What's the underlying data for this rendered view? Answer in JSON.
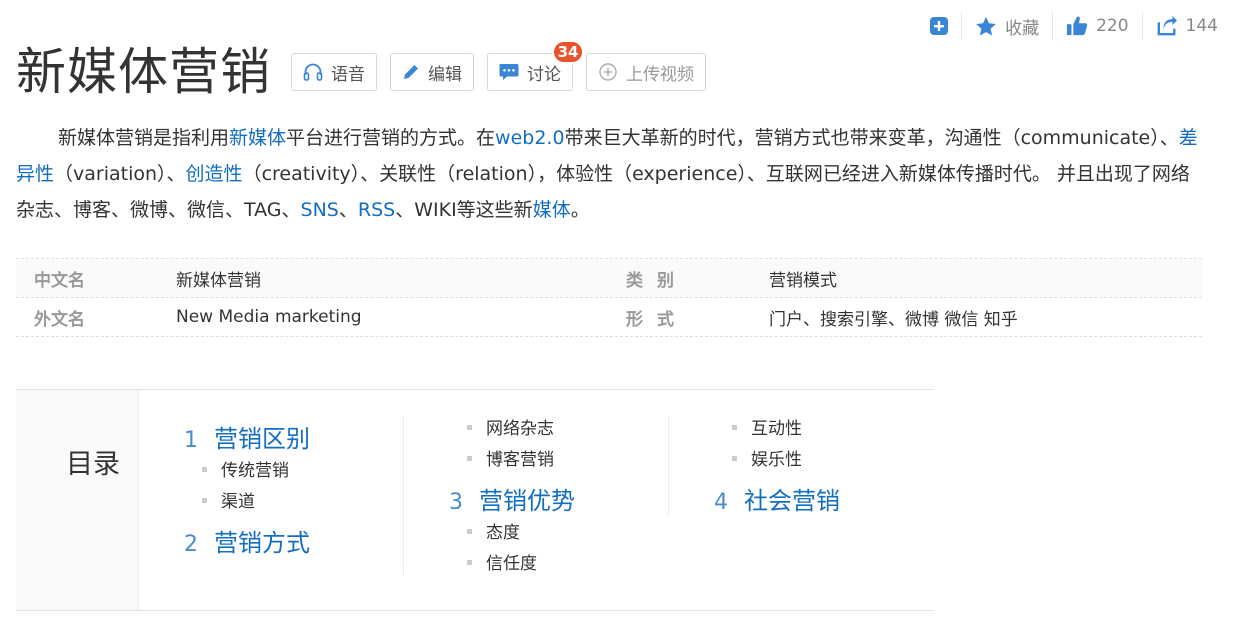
{
  "actions": {
    "collect_label": "收藏",
    "like_count": "220",
    "share_count": "144"
  },
  "title": "新媒体营销",
  "title_buttons": {
    "voice": "语音",
    "edit": "编辑",
    "discuss": "讨论",
    "discuss_badge": "34",
    "upload_video": "上传视频"
  },
  "summary": {
    "p1": "新媒体营销是指利用",
    "l1": "新媒体",
    "p2": "平台进行营销的方式。在",
    "l2": "web2.0",
    "p3": "带来巨大革新的时代，营销方式也带来变革，沟通性（communicate）、",
    "l3": "差异性",
    "p4": "（variation）、",
    "l4": "创造性",
    "p5": "（creativity）、关联性（relation），体验性（experience）、互联网已经进入新媒体传播时代。 并且出现了网络杂志、博客、微博、微信、TAG、",
    "l5": "SNS",
    "p6": "、",
    "l6": "RSS",
    "p7": "、WIKI等这些新",
    "l7": "媒体",
    "p8": "。"
  },
  "basic_info": [
    {
      "k1": "中文名",
      "v1": "新媒体营销",
      "k2": "类别",
      "v2": "营销模式"
    },
    {
      "k1": "外文名",
      "v1": "New Media marketing",
      "k2": "形式",
      "v2": "门户、搜索引擎、微博 微信 知乎"
    }
  ],
  "catalog": {
    "title": "目录",
    "sections": [
      {
        "num": "1",
        "label": "营销区别",
        "subs": [
          "传统营销",
          "渠道"
        ]
      },
      {
        "num": "2",
        "label": "营销方式",
        "subs": [
          "网络杂志",
          "博客营销"
        ]
      },
      {
        "num": "3",
        "label": "营销优势",
        "subs": [
          "态度",
          "信任度",
          "互动性",
          "娱乐性"
        ]
      },
      {
        "num": "4",
        "label": "社会营销",
        "subs": []
      }
    ]
  },
  "colors": {
    "link": "#136ec2",
    "badge": "#e8542c",
    "icon_blue": "#3a86d6"
  }
}
